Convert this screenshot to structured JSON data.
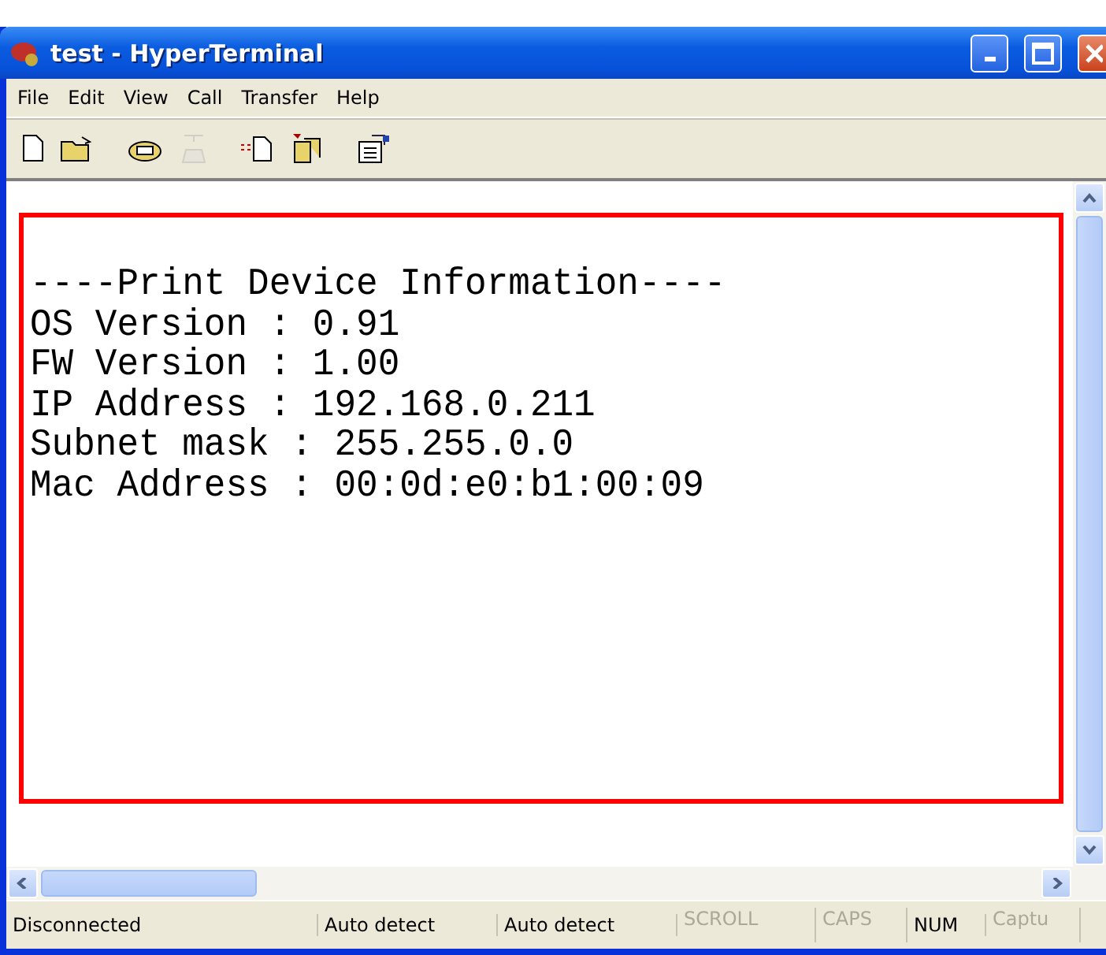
{
  "window": {
    "title": "test - HyperTerminal"
  },
  "menu": [
    "File",
    "Edit",
    "View",
    "Call",
    "Transfer",
    "Help"
  ],
  "toolbar": [
    {
      "disabled": false
    },
    {
      "disabled": false
    },
    {
      "disabled": false
    },
    {
      "disabled": true
    },
    {
      "disabled": false
    },
    {
      "disabled": false
    },
    {
      "disabled": false
    }
  ],
  "terminal": {
    "lines": [
      "----Print Device Information----",
      "OS Version : 0.91",
      "FW Version : 1.00",
      "IP Address : 192.168.0.211",
      "Subnet mask : 255.255.0.0",
      "Mac Address : 00:0d:e0:b1:00:09"
    ],
    "highlighted": true
  },
  "status_bar": [
    {
      "text": "Disconnected",
      "disabled": false
    },
    {
      "text": "Auto detect",
      "disabled": false
    },
    {
      "text": "Auto detect",
      "disabled": false
    },
    {
      "text": "SCROLL",
      "disabled": true
    },
    {
      "text": "CAPS",
      "disabled": true
    },
    {
      "text": "NUM",
      "disabled": false
    },
    {
      "text": "Captu",
      "disabled": true
    }
  ]
}
